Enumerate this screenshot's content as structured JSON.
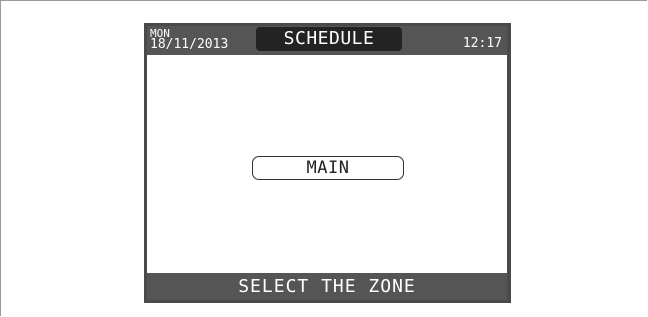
{
  "header": {
    "day": "MON",
    "date": "18/11/2013",
    "title": "SCHEDULE",
    "time": "12:17"
  },
  "main": {
    "zone_option": "MAIN"
  },
  "footer": {
    "prompt": "SELECT THE ZONE"
  }
}
